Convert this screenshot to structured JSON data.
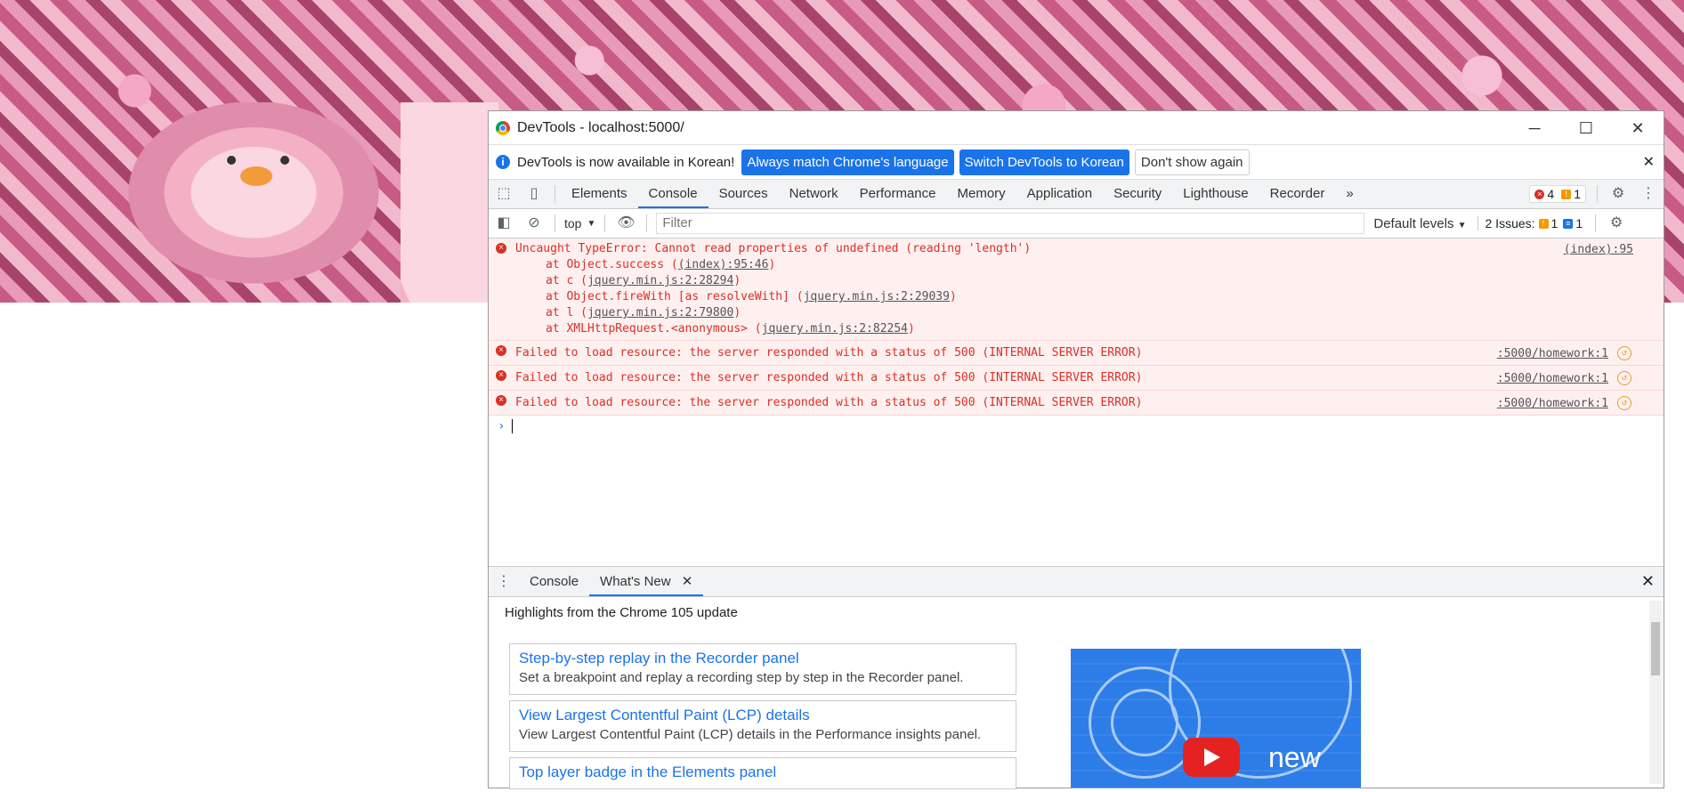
{
  "window": {
    "title": "DevTools - localhost:5000/",
    "minimize": "─",
    "maximize": "☐",
    "close": "✕"
  },
  "infobar": {
    "message": "DevTools is now available in Korean!",
    "btn_match": "Always match Chrome's language",
    "btn_switch": "Switch DevTools to Korean",
    "btn_dismiss": "Don't show again",
    "close": "✕"
  },
  "tabs": {
    "items": [
      "Elements",
      "Console",
      "Sources",
      "Network",
      "Performance",
      "Memory",
      "Application",
      "Security",
      "Lighthouse",
      "Recorder"
    ],
    "more": "»",
    "errors_count": "4",
    "warnings_count": "1"
  },
  "filterbar": {
    "context": "top",
    "filter_placeholder": "Filter",
    "levels": "Default levels",
    "issues_label": "2 Issues:",
    "issues_warn": "1",
    "issues_info": "1"
  },
  "console": {
    "error1": {
      "text": "Uncaught TypeError: Cannot read properties of undefined (reading 'length')",
      "source": "(index):95",
      "trace": [
        {
          "pre": "at Object.success (",
          "link": "(index):95:46",
          "post": ")"
        },
        {
          "pre": "at c (",
          "link": "jquery.min.js:2:28294",
          "post": ")"
        },
        {
          "pre": "at Object.fireWith [as resolveWith] (",
          "link": "jquery.min.js:2:29039",
          "post": ")"
        },
        {
          "pre": "at l (",
          "link": "jquery.min.js:2:79800",
          "post": ")"
        },
        {
          "pre": "at XMLHttpRequest.<anonymous> (",
          "link": "jquery.min.js:2:82254",
          "post": ")"
        }
      ]
    },
    "failed": [
      {
        "text": "Failed to load resource: the server responded with a status of 500 (INTERNAL SERVER ERROR)",
        "source": ":5000/homework:1"
      },
      {
        "text": "Failed to load resource: the server responded with a status of 500 (INTERNAL SERVER ERROR)",
        "source": ":5000/homework:1"
      },
      {
        "text": "Failed to load resource: the server responded with a status of 500 (INTERNAL SERVER ERROR)",
        "source": ":5000/homework:1"
      }
    ],
    "prompt": "›"
  },
  "drawer": {
    "tab_console": "Console",
    "tab_whatsnew": "What's New",
    "tab_close": "✕",
    "header": "Highlights from the Chrome 105 update",
    "cards": [
      {
        "title": "Step-by-step replay in the Recorder panel",
        "desc": "Set a breakpoint and replay a recording step by step in the Recorder panel."
      },
      {
        "title": "View Largest Contentful Paint (LCP) details",
        "desc": "View Largest Contentful Paint (LCP) details in the Performance insights panel."
      },
      {
        "title": "Top layer badge in the Elements panel",
        "desc": ""
      }
    ],
    "video_text": "new"
  }
}
